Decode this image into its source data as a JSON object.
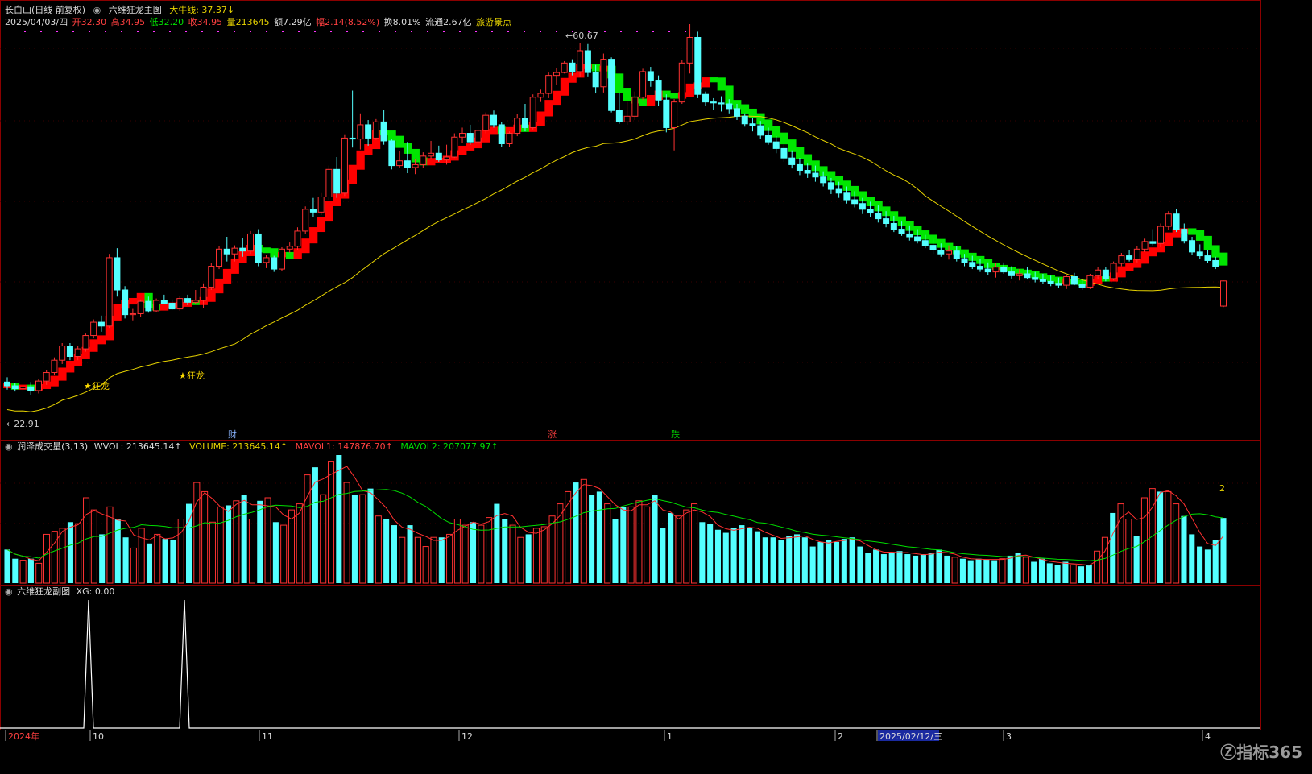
{
  "header": {
    "stock_title": "长白山(日线 前复权)",
    "main_indicator": "六维狂龙主图",
    "bull_line_label": "大牛线: 37.37↓",
    "date": "2025/04/03/四",
    "open": "开32.30",
    "high": "高34.95",
    "low": "低32.20",
    "close": "收34.95",
    "volume": "量213645",
    "amount": "额7.29亿",
    "change": "幅2.14(8.52%)",
    "turnover": "换8.01%",
    "float": "流通2.67亿",
    "sector": "旅游景点"
  },
  "vol_panel": {
    "title": "润泽成交量(3,13)",
    "wvol": "WVOL: 213645.14↑",
    "volume": "VOLUME: 213645.14↑",
    "mavol1": "MAVOL1: 147876.70↑",
    "mavol2": "MAVOL2: 207077.97↑",
    "marker": "2"
  },
  "sub_panel": {
    "title": "六维狂龙副图",
    "xg": "XG: 0.00"
  },
  "annotations": {
    "high_label": "60.67",
    "low_label": "22.91",
    "signal_label": "★狂龙",
    "event_cai": "财",
    "event_zhang": "涨",
    "event_die": "跌"
  },
  "x_axis": {
    "labels": [
      "2024年",
      "10",
      "11",
      "12",
      "1",
      "2",
      "2025/02/12/三",
      "3",
      "4"
    ]
  },
  "watermark": "指标365",
  "colors": {
    "up": "#ff3232",
    "down": "#54ffff",
    "band_up": "#ff0000",
    "band_down": "#00e600",
    "bull_line": "#e6d200",
    "ma1": "#ff3030",
    "ma2": "#00dd00",
    "grid": "#8b0000"
  },
  "chart_data": [
    {
      "type": "candlestick",
      "series_name": "长白山",
      "ylim": [
        20,
        62
      ],
      "candles": [
        [
          24.3,
          24.8,
          23.5,
          23.9
        ],
        [
          23.9,
          24.2,
          23.3,
          23.6
        ],
        [
          23.6,
          24.0,
          23.2,
          23.8
        ],
        [
          23.8,
          24.3,
          22.9,
          23.4
        ],
        [
          23.4,
          24.6,
          23.1,
          24.4
        ],
        [
          24.4,
          25.6,
          24.0,
          25.3
        ],
        [
          25.3,
          26.9,
          25.0,
          26.6
        ],
        [
          26.6,
          28.4,
          26.2,
          28.1
        ],
        [
          28.1,
          28.4,
          26.6,
          27.0
        ],
        [
          27.0,
          28.1,
          26.6,
          27.8
        ],
        [
          27.8,
          29.4,
          27.5,
          29.2
        ],
        [
          29.2,
          30.9,
          28.9,
          30.6
        ],
        [
          30.6,
          31.3,
          29.6,
          30.2
        ],
        [
          30.2,
          37.8,
          30.0,
          37.4
        ],
        [
          37.4,
          38.4,
          33.3,
          34.0
        ],
        [
          34.0,
          34.4,
          31.0,
          31.4
        ],
        [
          31.4,
          32.0,
          30.8,
          31.5
        ],
        [
          31.5,
          33.0,
          31.2,
          32.8
        ],
        [
          32.8,
          33.3,
          31.6,
          31.8
        ],
        [
          31.8,
          33.1,
          31.7,
          32.9
        ],
        [
          32.9,
          33.5,
          32.5,
          32.6
        ],
        [
          32.6,
          33.0,
          31.9,
          32.0
        ],
        [
          32.0,
          33.4,
          31.8,
          33.1
        ],
        [
          33.1,
          33.5,
          32.4,
          32.7
        ],
        [
          32.7,
          34.0,
          32.5,
          32.9
        ],
        [
          32.9,
          34.7,
          32.1,
          34.3
        ],
        [
          34.3,
          36.8,
          34.0,
          36.5
        ],
        [
          36.5,
          38.6,
          36.2,
          38.3
        ],
        [
          38.3,
          39.6,
          37.0,
          37.8
        ],
        [
          37.8,
          38.7,
          37.0,
          38.4
        ],
        [
          38.4,
          39.5,
          37.5,
          38.1
        ],
        [
          38.1,
          40.2,
          37.8,
          39.9
        ],
        [
          39.9,
          40.4,
          36.5,
          36.9
        ],
        [
          36.9,
          37.7,
          36.3,
          37.4
        ],
        [
          37.4,
          37.6,
          35.9,
          36.2
        ],
        [
          36.2,
          38.5,
          36.0,
          38.3
        ],
        [
          38.3,
          39.0,
          37.9,
          38.6
        ],
        [
          38.6,
          40.6,
          38.2,
          40.2
        ],
        [
          40.2,
          42.8,
          39.9,
          42.5
        ],
        [
          42.5,
          43.7,
          41.7,
          42.2
        ],
        [
          42.2,
          44.2,
          41.9,
          43.8
        ],
        [
          43.8,
          47.1,
          43.5,
          46.7
        ],
        [
          46.7,
          48.0,
          43.7,
          44.2
        ],
        [
          44.2,
          50.4,
          43.9,
          50.0
        ],
        [
          50.0,
          55.0,
          49.0,
          49.9
        ],
        [
          49.9,
          52.6,
          48.8,
          51.4
        ],
        [
          51.4,
          51.9,
          49.2,
          50.0
        ],
        [
          50.0,
          52.0,
          49.8,
          51.7
        ],
        [
          51.7,
          53.0,
          49.3,
          49.7
        ],
        [
          49.7,
          49.9,
          46.7,
          47.1
        ],
        [
          47.1,
          48.6,
          46.9,
          47.6
        ],
        [
          47.6,
          49.6,
          46.3,
          46.9
        ],
        [
          46.9,
          47.8,
          46.2,
          47.2
        ],
        [
          47.2,
          48.5,
          46.9,
          48.1
        ],
        [
          48.1,
          49.7,
          47.8,
          48.4
        ],
        [
          48.4,
          49.2,
          47.5,
          47.7
        ],
        [
          47.7,
          49.3,
          47.2,
          48.0
        ],
        [
          48.0,
          50.5,
          47.9,
          50.1
        ],
        [
          50.1,
          51.1,
          49.5,
          50.5
        ],
        [
          50.5,
          51.4,
          49.3,
          49.6
        ],
        [
          49.6,
          51.2,
          49.2,
          50.8
        ],
        [
          50.8,
          52.7,
          50.5,
          52.4
        ],
        [
          52.4,
          52.9,
          51.1,
          51.4
        ],
        [
          51.4,
          51.7,
          49.1,
          49.4
        ],
        [
          49.4,
          50.7,
          49.1,
          50.5
        ],
        [
          50.5,
          52.5,
          50.2,
          52.1
        ],
        [
          52.1,
          53.6,
          50.7,
          51.1
        ],
        [
          51.1,
          54.6,
          50.9,
          54.3
        ],
        [
          54.3,
          55.1,
          53.8,
          54.7
        ],
        [
          54.7,
          56.9,
          54.2,
          56.6
        ],
        [
          56.6,
          57.4,
          55.6,
          56.9
        ],
        [
          56.9,
          58.1,
          56.8,
          57.9
        ],
        [
          57.9,
          58.3,
          56.6,
          57.0
        ],
        [
          57.0,
          60.0,
          56.5,
          59.2
        ],
        [
          59.2,
          59.9,
          56.5,
          56.9
        ],
        [
          56.9,
          57.7,
          54.7,
          55.4
        ],
        [
          55.4,
          58.9,
          54.8,
          58.3
        ],
        [
          58.3,
          58.5,
          52.7,
          52.9
        ],
        [
          52.9,
          54.8,
          51.5,
          51.7
        ],
        [
          51.7,
          53.8,
          51.4,
          52.3
        ],
        [
          52.3,
          54.9,
          51.9,
          54.3
        ],
        [
          54.3,
          57.3,
          54.0,
          57.0
        ],
        [
          57.0,
          57.5,
          55.4,
          56.1
        ],
        [
          56.1,
          56.6,
          53.4,
          54.0
        ],
        [
          54.0,
          54.6,
          50.6,
          51.1
        ],
        [
          51.1,
          54.1,
          48.7,
          53.8
        ],
        [
          53.8,
          58.2,
          53.6,
          57.9
        ],
        [
          57.9,
          62.0,
          56.8,
          60.6
        ],
        [
          60.6,
          61.2,
          54.2,
          54.6
        ],
        [
          54.6,
          54.9,
          53.4,
          53.8
        ],
        [
          53.8,
          54.2,
          53.0,
          53.7
        ],
        [
          53.7,
          54.4,
          52.8,
          53.6
        ],
        [
          53.6,
          54.1,
          52.6,
          53.1
        ],
        [
          53.1,
          53.6,
          51.9,
          52.3
        ],
        [
          52.3,
          52.6,
          51.2,
          51.5
        ],
        [
          51.5,
          52.1,
          50.7,
          51.3
        ],
        [
          51.3,
          51.8,
          49.9,
          50.3
        ],
        [
          50.3,
          51.1,
          49.3,
          49.6
        ],
        [
          49.6,
          50.2,
          48.4,
          48.9
        ],
        [
          48.9,
          49.3,
          47.5,
          47.9
        ],
        [
          47.9,
          48.7,
          46.8,
          47.2
        ],
        [
          47.2,
          47.9,
          46.1,
          46.6
        ],
        [
          46.6,
          47.3,
          45.8,
          46.3
        ],
        [
          46.3,
          47.1,
          45.4,
          45.9
        ],
        [
          45.9,
          46.5,
          44.9,
          45.3
        ],
        [
          45.3,
          45.8,
          44.1,
          44.6
        ],
        [
          44.6,
          45.4,
          43.7,
          44.2
        ],
        [
          44.2,
          44.9,
          43.1,
          43.5
        ],
        [
          43.5,
          44.4,
          42.7,
          43.1
        ],
        [
          43.1,
          43.7,
          42.0,
          42.5
        ],
        [
          42.5,
          43.3,
          41.7,
          42.1
        ],
        [
          42.1,
          42.9,
          41.1,
          41.5
        ],
        [
          41.5,
          42.3,
          40.6,
          41.0
        ],
        [
          41.0,
          41.8,
          40.1,
          40.4
        ],
        [
          40.4,
          41.2,
          39.7,
          39.9
        ],
        [
          39.9,
          40.8,
          39.2,
          39.6
        ],
        [
          39.6,
          40.4,
          38.9,
          39.2
        ],
        [
          39.2,
          39.8,
          38.4,
          38.7
        ],
        [
          38.7,
          39.4,
          37.8,
          38.2
        ],
        [
          38.2,
          38.9,
          37.5,
          37.8
        ],
        [
          37.8,
          38.7,
          37.2,
          38.1
        ],
        [
          38.1,
          38.6,
          37.0,
          37.3
        ],
        [
          37.3,
          37.8,
          36.5,
          36.9
        ],
        [
          36.9,
          37.6,
          36.2,
          36.5
        ],
        [
          36.5,
          37.3,
          35.9,
          36.2
        ],
        [
          36.2,
          36.9,
          35.6,
          35.9
        ],
        [
          35.9,
          36.8,
          35.3,
          36.4
        ],
        [
          36.4,
          36.9,
          35.7,
          35.9
        ],
        [
          35.9,
          36.5,
          35.2,
          35.5
        ],
        [
          35.5,
          36.2,
          35.0,
          35.7
        ],
        [
          35.7,
          36.4,
          35.1,
          35.3
        ],
        [
          35.3,
          35.9,
          34.8,
          35.1
        ],
        [
          35.1,
          35.7,
          34.6,
          34.9
        ],
        [
          34.9,
          35.5,
          34.4,
          34.7
        ],
        [
          34.7,
          35.3,
          34.2,
          34.5
        ],
        [
          34.5,
          35.6,
          34.1,
          35.4
        ],
        [
          35.4,
          35.8,
          34.5,
          34.6
        ],
        [
          34.6,
          35.2,
          34.0,
          34.3
        ],
        [
          34.3,
          35.7,
          34.1,
          35.5
        ],
        [
          35.5,
          36.4,
          35.1,
          36.1
        ],
        [
          36.1,
          36.4,
          34.9,
          35.2
        ],
        [
          35.2,
          37.0,
          35.0,
          36.8
        ],
        [
          36.8,
          37.9,
          36.5,
          37.6
        ],
        [
          37.6,
          38.2,
          37.0,
          37.2
        ],
        [
          37.2,
          38.6,
          36.9,
          38.3
        ],
        [
          38.3,
          39.4,
          38.0,
          39.1
        ],
        [
          39.1,
          40.4,
          38.7,
          38.9
        ],
        [
          38.9,
          41.0,
          38.5,
          40.7
        ],
        [
          40.7,
          42.3,
          40.3,
          42.0
        ],
        [
          42.0,
          42.5,
          40.1,
          40.4
        ],
        [
          40.4,
          41.0,
          38.9,
          39.2
        ],
        [
          39.2,
          39.6,
          37.7,
          38.0
        ],
        [
          38.0,
          38.8,
          37.3,
          37.6
        ],
        [
          37.6,
          38.2,
          36.8,
          37.1
        ],
        [
          37.1,
          37.5,
          36.2,
          36.5
        ],
        [
          32.3,
          35.0,
          32.2,
          34.95
        ]
      ],
      "bull_line": "37.37",
      "price_high": 60.67,
      "price_low": 22.91
    },
    {
      "type": "bar",
      "series_name": "润泽成交量",
      "ylim": [
        0,
        420000
      ],
      "volume": [
        110,
        80,
        75,
        80,
        65,
        160,
        170,
        180,
        200,
        195,
        280,
        240,
        160,
        250,
        210,
        150,
        115,
        180,
        130,
        160,
        145,
        140,
        210,
        260,
        330,
        300,
        200,
        250,
        255,
        270,
        290,
        210,
        270,
        280,
        200,
        190,
        240,
        260,
        355,
        380,
        290,
        400,
        420,
        330,
        290,
        290,
        310,
        220,
        210,
        190,
        150,
        190,
        150,
        120,
        150,
        150,
        160,
        210,
        190,
        200,
        190,
        215,
        260,
        210,
        190,
        150,
        160,
        180,
        185,
        220,
        260,
        300,
        330,
        340,
        290,
        300,
        260,
        210,
        250,
        250,
        270,
        250,
        290,
        180,
        230,
        220,
        240,
        260,
        200,
        195,
        175,
        165,
        180,
        190,
        180,
        170,
        150,
        150,
        140,
        155,
        160,
        150,
        120,
        135,
        140,
        135,
        145,
        150,
        120,
        100,
        110,
        95,
        100,
        105,
        95,
        90,
        95,
        100,
        110,
        90,
        85,
        80,
        75,
        80,
        78,
        75,
        80,
        90,
        100,
        85,
        70,
        80,
        65,
        60,
        70,
        60,
        55,
        60,
        105,
        150,
        230,
        260,
        210,
        155,
        280,
        310,
        300,
        300,
        260,
        220,
        160,
        120,
        110,
        140,
        213.6
      ],
      "mavol1": 147876.7,
      "mavol2": 207077.97
    },
    {
      "type": "line",
      "series_name": "六维狂龙副图",
      "xg": [
        0,
        0,
        0,
        0,
        0,
        0,
        0,
        0,
        0,
        0,
        0,
        0,
        1,
        0,
        0,
        0,
        0,
        0,
        0,
        0,
        0,
        0,
        0,
        0,
        0,
        0,
        1,
        0
      ]
    }
  ]
}
